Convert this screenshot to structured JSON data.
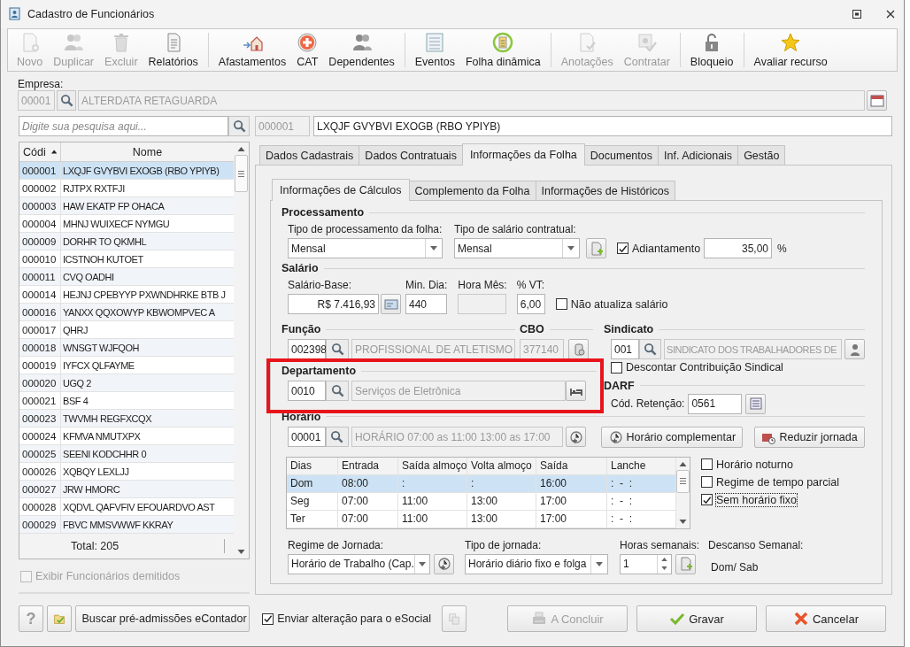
{
  "window": {
    "title": "Cadastro de Funcionários"
  },
  "toolbar": [
    {
      "label": "Novo",
      "disabled": true,
      "group_end": false
    },
    {
      "label": "Duplicar",
      "disabled": true,
      "group_end": false
    },
    {
      "label": "Excluir",
      "disabled": true,
      "group_end": false
    },
    {
      "label": "Relatórios",
      "disabled": false,
      "group_end": true
    },
    {
      "label": "Afastamentos",
      "disabled": false,
      "group_end": false
    },
    {
      "label": "CAT",
      "disabled": false,
      "group_end": false
    },
    {
      "label": "Dependentes",
      "disabled": false,
      "group_end": true
    },
    {
      "label": "Eventos",
      "disabled": false,
      "group_end": false
    },
    {
      "label": "Folha dinâmica",
      "disabled": false,
      "group_end": true
    },
    {
      "label": "Anotações",
      "disabled": true,
      "group_end": false
    },
    {
      "label": "Contratar",
      "disabled": true,
      "group_end": true
    },
    {
      "label": "Bloqueio",
      "disabled": false,
      "group_end": true
    },
    {
      "label": "Avaliar recurso",
      "disabled": false,
      "group_end": false
    }
  ],
  "company": {
    "label": "Empresa:",
    "code": "00001",
    "name": "ALTERDATA RETAGUARDA"
  },
  "employee_search": {
    "placeholder": "Digite sua pesquisa aqui..."
  },
  "employee_list": {
    "columns": [
      "Códi",
      "Nome"
    ],
    "rows": [
      {
        "code": "000001",
        "name": "LXQJF GVYBVI EXOGB (RBO YPIYB)",
        "selected": true
      },
      {
        "code": "000002",
        "name": "RJTPX RXTFJI",
        "selected": false
      },
      {
        "code": "000003",
        "name": "HAW EKATP FP OHACA",
        "selected": false
      },
      {
        "code": "000004",
        "name": "MHNJ WUIXECF NYMGU",
        "selected": false
      },
      {
        "code": "000009",
        "name": "DORHR TO QKMHL",
        "selected": false
      },
      {
        "code": "000010",
        "name": "ICSTNOH KUTOET",
        "selected": false
      },
      {
        "code": "000011",
        "name": "CVQ OADHI",
        "selected": false
      },
      {
        "code": "000014",
        "name": "HEJNJ CPEBYYP PXWNDHRKE BTB J",
        "selected": false
      },
      {
        "code": "000016",
        "name": "YANXX QQXOWYP KBWOMPVEC A",
        "selected": false
      },
      {
        "code": "000017",
        "name": "QHRJ",
        "selected": false
      },
      {
        "code": "000018",
        "name": "WNSGT WJFQOH",
        "selected": false
      },
      {
        "code": "000019",
        "name": "IYFCX QLFAYME",
        "selected": false
      },
      {
        "code": "000020",
        "name": "UGQ 2",
        "selected": false
      },
      {
        "code": "000021",
        "name": "BSF 4",
        "selected": false
      },
      {
        "code": "000023",
        "name": "TWVMH REGFXCQX",
        "selected": false
      },
      {
        "code": "000024",
        "name": "KFMVA NMUTXPX",
        "selected": false
      },
      {
        "code": "000025",
        "name": "SEENI KODCHHR 0",
        "selected": false
      },
      {
        "code": "000026",
        "name": "XQBQY LEXLJJ",
        "selected": false
      },
      {
        "code": "000027",
        "name": "JRW HMORC",
        "selected": false
      },
      {
        "code": "000028",
        "name": "XQDVL QAFVFIV EFOUARDVO AST",
        "selected": false
      },
      {
        "code": "000029",
        "name": "FBVC MMSVWWF KKRAY",
        "selected": false
      }
    ],
    "total": "Total: 205"
  },
  "show_dismissed": {
    "label": "Exibir Funcionários demitidos",
    "checked": false,
    "disabled": true
  },
  "left_footer": {
    "help": "?",
    "econtador": "Buscar pré-admissões eContador"
  },
  "employee": {
    "code": "000001",
    "name": "LXQJF GVYBVI EXOGB (RBO YPIYB)"
  },
  "tabs": [
    {
      "label": "Dados Cadastrais",
      "selected": false
    },
    {
      "label": "Dados Contratuais",
      "selected": false
    },
    {
      "label": "Informações da Folha",
      "selected": true
    },
    {
      "label": "Documentos",
      "selected": false
    },
    {
      "label": "Inf. Adicionais",
      "selected": false
    },
    {
      "label": "Gestão",
      "selected": false
    }
  ],
  "subtabs": [
    {
      "label": "Informações de Cálculos",
      "selected": true
    },
    {
      "label": "Complemento da Folha",
      "selected": false
    },
    {
      "label": "Informações de  Históricos",
      "selected": false
    }
  ],
  "processamento": {
    "title": "Processamento",
    "processing_type": {
      "label": "Tipo de processamento da folha:",
      "value": "Mensal"
    },
    "salary_type": {
      "label": "Tipo de salário contratual:",
      "value": "Mensal"
    },
    "advance": {
      "label": "Adiantamento",
      "checked": true,
      "value": "35,00",
      "unit": "%"
    }
  },
  "salario": {
    "title": "Salário",
    "base": {
      "label": "Salário-Base:",
      "value": "R$ 7.416,93"
    },
    "min_dia": {
      "label": "Min. Dia:",
      "value": "440"
    },
    "hora_mes": {
      "label": "Hora Mês:"
    },
    "vt": {
      "label": "% VT:",
      "value": "6,00"
    },
    "no_update": {
      "label": "Não atualiza salário",
      "checked": false
    }
  },
  "funcao": {
    "title": "Função",
    "code": "002398",
    "name": "PROFISSIONAL DE ATLETISMO"
  },
  "cbo": {
    "title": "CBO",
    "value": "377140"
  },
  "departamento": {
    "title": "Departamento",
    "code": "0010",
    "name": "Serviços de Eletrônica",
    "highlighted": true
  },
  "sindicato": {
    "title": "Sindicato",
    "code": "001",
    "name": "SINDICATO DOS TRABALHADORES DE",
    "discount": {
      "label": "Descontar Contribuição Sindical",
      "checked": false
    }
  },
  "darf": {
    "title": "DARF",
    "label": "Cód. Retenção:",
    "value": "0561"
  },
  "horario": {
    "title": "Horário",
    "code": "00001",
    "name": "HORÁRIO 07:00 as 11:00  13:00 as 17:00",
    "buttons": [
      "Horário complementar",
      "Reduzir jornada"
    ],
    "columns": [
      "Dias",
      "Entrada",
      "Saída almoço",
      "Volta almoço",
      "Saída",
      "Lanche"
    ],
    "rows": [
      {
        "cells": [
          "Dom",
          "08:00",
          ":",
          ":",
          "16:00",
          ":  -  :"
        ],
        "selected": true
      },
      {
        "cells": [
          "Seg",
          "07:00",
          "11:00",
          "13:00",
          "17:00",
          ":  -  :"
        ],
        "selected": false
      },
      {
        "cells": [
          "Ter",
          "07:00",
          "11:00",
          "13:00",
          "17:00",
          ":  -  :"
        ],
        "selected": false
      }
    ],
    "options": [
      {
        "label": "Horário noturno",
        "checked": false,
        "focused": false
      },
      {
        "label": "Regime de tempo parcial",
        "checked": false,
        "focused": false
      },
      {
        "label": "Sem horário fixo",
        "checked": true,
        "focused": true
      }
    ]
  },
  "jornada": {
    "regime": {
      "label": "Regime de Jornada:",
      "value": "Horário de Trabalho (Cap."
    },
    "tipo": {
      "label": "Tipo de jornada:",
      "value": "Horário diário fixo e folga"
    },
    "horas": {
      "label": "Horas semanais:",
      "value": "1"
    },
    "descanso": {
      "label": "Descanso Semanal:",
      "value": "Dom/ Sab"
    }
  },
  "footer": {
    "esocial": {
      "label": "Enviar alteração para o eSocial",
      "checked": true
    },
    "buttons": [
      {
        "label": "A Concluir",
        "disabled": true
      },
      {
        "label": "Gravar",
        "disabled": false
      },
      {
        "label": "Cancelar",
        "disabled": false
      }
    ]
  }
}
